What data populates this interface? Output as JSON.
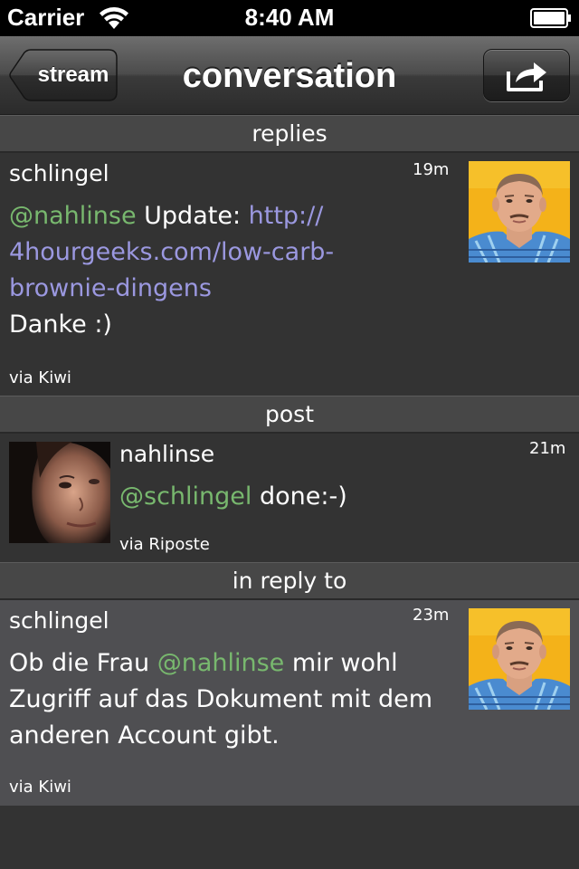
{
  "status_bar": {
    "carrier": "Carrier",
    "time": "8:40 AM"
  },
  "nav": {
    "back_label": "stream",
    "title": "conversation",
    "share_icon": "share-arrow-icon"
  },
  "sections": {
    "replies": "replies",
    "post": "post",
    "in_reply_to": "in reply to"
  },
  "reply_post": {
    "username": "schlingel",
    "time": "19m",
    "mention": "@nahlinse",
    "text_before_link": " Update: ",
    "link_line1": "http://",
    "link_line2": "4hourgeeks.com/low-carb-",
    "link_line3": "brownie-dingens",
    "text_after": "Danke :)",
    "via": "via Kiwi"
  },
  "main_post": {
    "username": "nahlinse",
    "time": "21m",
    "mention": "@schlingel",
    "text": " done:-)",
    "via": "via Riposte"
  },
  "origin_post": {
    "username": "schlingel",
    "time": "23m",
    "text_before": "Ob die Frau ",
    "mention": "@nahlinse",
    "text_after_line1": " mir wohl",
    "line2": "Zugriff auf das Dokument mit dem",
    "line3": "anderen Account gibt.",
    "via": "via Kiwi"
  },
  "colors": {
    "mention": "#78b86e",
    "link": "#9b98e0",
    "background": "#333333",
    "origin_background": "#4f4f52"
  }
}
